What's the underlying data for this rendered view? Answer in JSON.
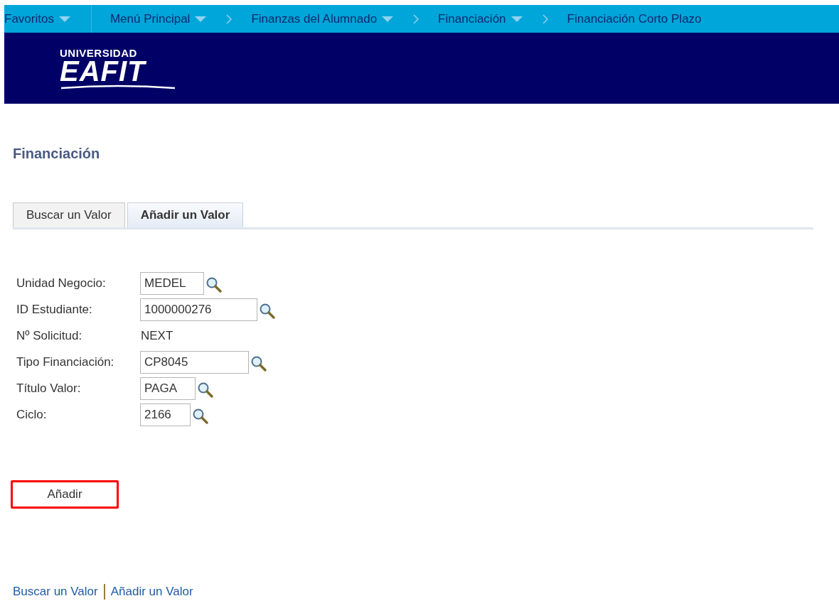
{
  "nav": [
    {
      "label": "Favoritos",
      "dropdown": true,
      "divider_before": false,
      "chevron_before": false
    },
    {
      "label": "Menú Principal",
      "dropdown": true,
      "divider_before": true,
      "chevron_before": false
    },
    {
      "label": "Finanzas del Alumnado",
      "dropdown": true,
      "divider_before": false,
      "chevron_before": true
    },
    {
      "label": "Financiación",
      "dropdown": true,
      "divider_before": false,
      "chevron_before": true
    },
    {
      "label": "Financiación Corto Plazo",
      "dropdown": false,
      "divider_before": false,
      "chevron_before": true
    }
  ],
  "logo": {
    "line_1": "UNIVERSIDAD",
    "line_2": "EAFIT"
  },
  "page_title": "Financiación",
  "tabs": [
    {
      "label": "Buscar un Valor",
      "selected": false
    },
    {
      "label": "Añadir un Valor",
      "selected": true
    }
  ],
  "fields": [
    {
      "label": "Unidad Negocio:",
      "kind": "lookup",
      "value": "MEDEL"
    },
    {
      "label": "ID Estudiante:",
      "kind": "lookup",
      "value": "1000000276"
    },
    {
      "label": "Nº Solicitud:",
      "kind": "text",
      "value": "NEXT"
    },
    {
      "label": "Tipo Financiación:",
      "kind": "lookup",
      "value": "CP8045"
    },
    {
      "label": "Título Valor:",
      "kind": "lookup",
      "value": "PAGA"
    },
    {
      "label": "Ciclo:",
      "kind": "lookup",
      "value": "2166"
    }
  ],
  "add_button": {
    "label": "Añadir",
    "highlighted": true
  },
  "footer_links": [
    "Buscar un Valor",
    "Añadir un Valor"
  ]
}
